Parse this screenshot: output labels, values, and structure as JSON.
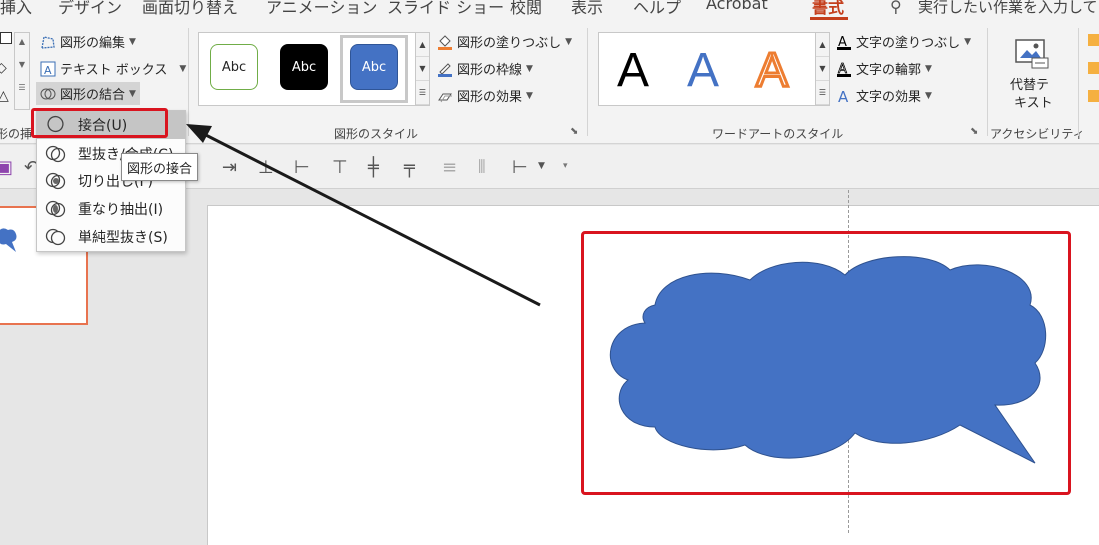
{
  "tabs": [
    {
      "label": "挿入"
    },
    {
      "label": "デザイン"
    },
    {
      "label": "画面切り替え"
    },
    {
      "label": "アニメーション"
    },
    {
      "label": "スライド ショー"
    },
    {
      "label": "校閲"
    },
    {
      "label": "表示"
    },
    {
      "label": "ヘルプ"
    },
    {
      "label": "Acrobat"
    },
    {
      "label": "書式"
    }
  ],
  "tell_me": "実行したい作業を入力して",
  "insert_shapes": {
    "edit_shape": "図形の編集",
    "text_box": "テキスト ボックス",
    "merge_shapes": "図形の結合",
    "group_label": "形の挿"
  },
  "shape_styles": {
    "swatches": [
      {
        "text": "Abc",
        "bg": "#ffffff",
        "fg": "#262626",
        "border": "#70ad47"
      },
      {
        "text": "Abc",
        "bg": "#000000",
        "fg": "#ffffff",
        "border": "#000000"
      },
      {
        "text": "Abc",
        "bg": "#4472c4",
        "fg": "#ffffff",
        "border": "#2f5597"
      }
    ],
    "fill": "図形の塗りつぶし",
    "outline": "図形の枠線",
    "effects": "図形の効果",
    "group_label": "図形のスタイル"
  },
  "wordart": {
    "letters": [
      {
        "text": "A",
        "color": "#000000"
      },
      {
        "text": "A",
        "color": "#4472c4"
      },
      {
        "text": "A",
        "color": "#ed7d31"
      }
    ],
    "text_fill": "文字の塗りつぶし",
    "text_outline": "文字の輪郭",
    "text_effects": "文字の効果",
    "group_label": "ワードアートのスタイル"
  },
  "accessibility": {
    "alt_text_line1": "代替テ",
    "alt_text_line2": "キスト",
    "group_label": "アクセシビリティ"
  },
  "merge_menu": {
    "items": [
      {
        "label": "接合(U)"
      },
      {
        "label": "型抜き/合成(C)"
      },
      {
        "label": "切り出し(F)"
      },
      {
        "label": "重なり抽出(I)"
      },
      {
        "label": "単純型抜き(S)"
      }
    ],
    "highlighted_index": 0
  },
  "tooltip": "図形の接合",
  "colors": {
    "accent": "#c43e1c",
    "highlight_box": "#d9141f",
    "shape_fill": "#4472c4",
    "shape_stroke": "#2f528f"
  }
}
